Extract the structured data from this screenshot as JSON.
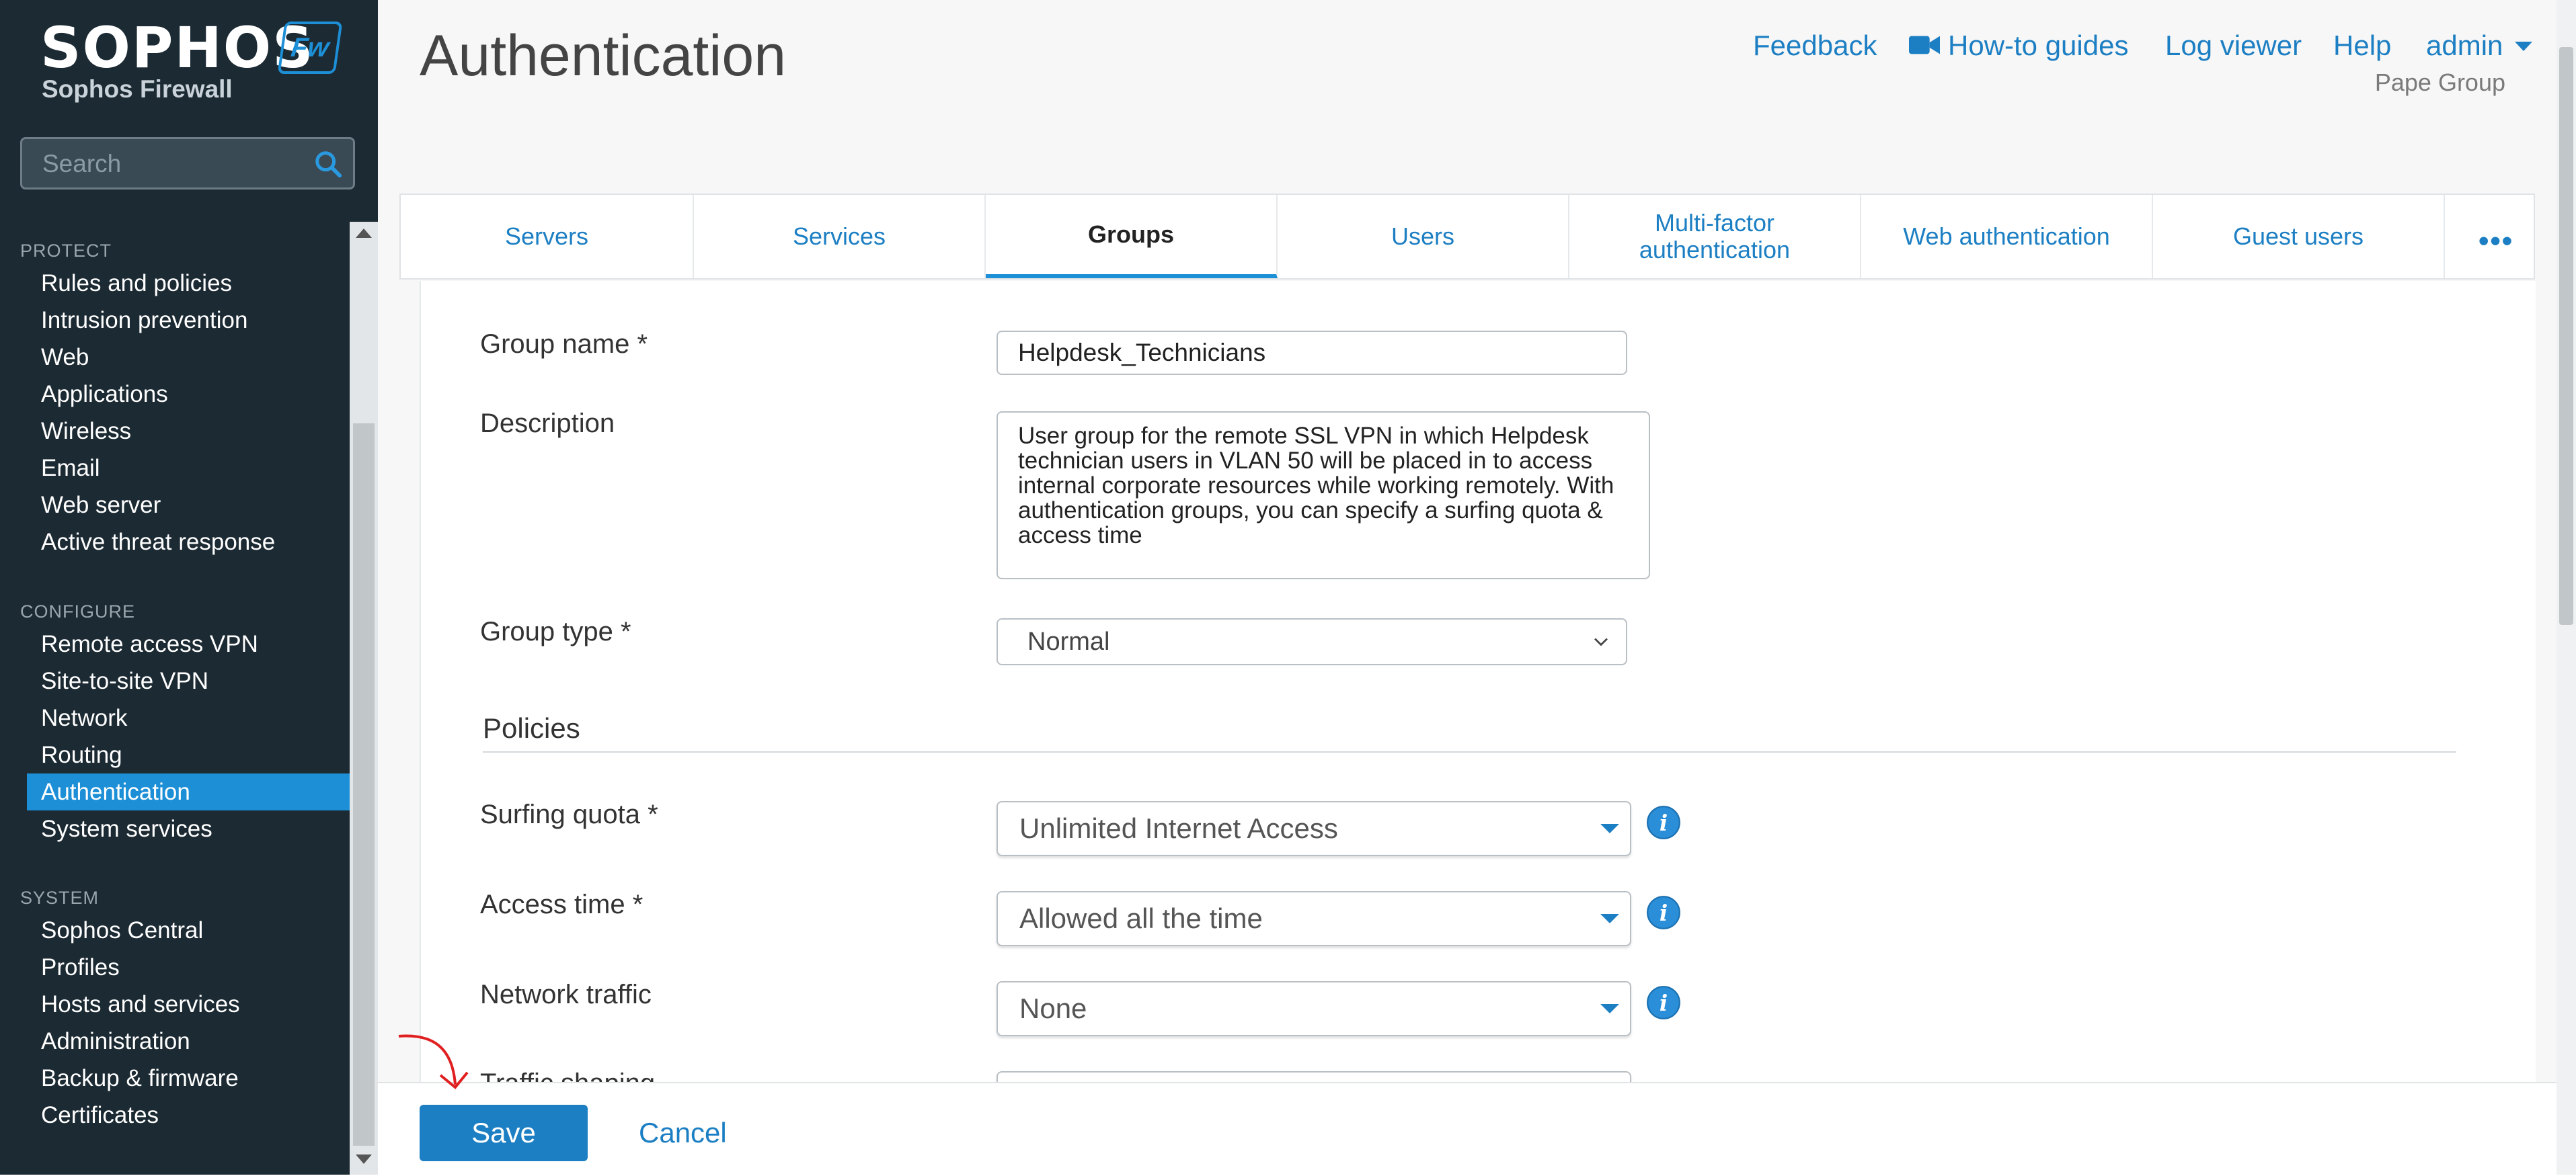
{
  "brand": {
    "name": "SOPHOS",
    "product": "Sophos Firewall",
    "badge": "Fw"
  },
  "search": {
    "placeholder": "Search"
  },
  "nav": {
    "sections": [
      {
        "title": "PROTECT",
        "items": [
          "Rules and policies",
          "Intrusion prevention",
          "Web",
          "Applications",
          "Wireless",
          "Email",
          "Web server",
          "Active threat response"
        ]
      },
      {
        "title": "CONFIGURE",
        "items": [
          "Remote access VPN",
          "Site-to-site VPN",
          "Network",
          "Routing",
          "Authentication",
          "System services"
        ]
      },
      {
        "title": "SYSTEM",
        "items": [
          "Sophos Central",
          "Profiles",
          "Hosts and services",
          "Administration",
          "Backup & firmware",
          "Certificates"
        ]
      }
    ],
    "active": "Authentication"
  },
  "header": {
    "title": "Authentication",
    "links": [
      "Feedback",
      "How-to guides",
      "Log viewer",
      "Help",
      "admin"
    ],
    "org": "Pape Group"
  },
  "tabs": {
    "items": [
      "Servers",
      "Services",
      "Groups",
      "Users",
      "Multi-factor authentication",
      "Web authentication",
      "Guest users"
    ],
    "active": "Groups",
    "more": "•••"
  },
  "form": {
    "group_name": {
      "label": "Group name *",
      "value": "Helpdesk_Technicians"
    },
    "description": {
      "label": "Description",
      "value": "User group for the remote SSL VPN in which Helpdesk technician users in VLAN 50 will be placed in to access internal corporate resources while working remotely. With authentication groups, you can specify a surfing quota & access time"
    },
    "group_type": {
      "label": "Group type *",
      "value": "Normal"
    },
    "policies_title": "Policies",
    "surfing_quota": {
      "label": "Surfing quota *",
      "value": "Unlimited Internet Access"
    },
    "access_time": {
      "label": "Access time *",
      "value": "Allowed all the time"
    },
    "network_traffic": {
      "label": "Network traffic",
      "value": "None"
    },
    "traffic_shaping": {
      "label": "Traffic shaping"
    }
  },
  "footer": {
    "save": "Save",
    "cancel": "Cancel"
  },
  "colors": {
    "sidebar_bg": "#1c2a33",
    "accent": "#1d8fd6",
    "link": "#1d7fc3"
  }
}
